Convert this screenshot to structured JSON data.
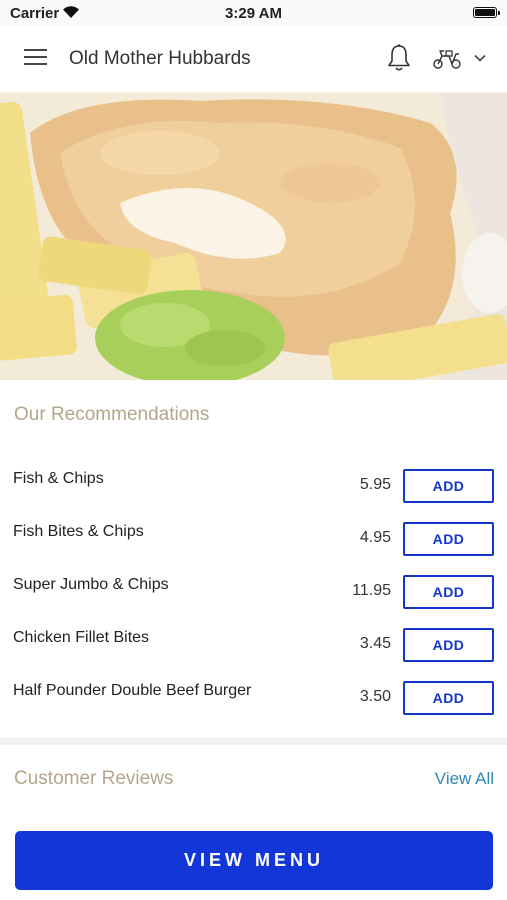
{
  "status_bar": {
    "carrier": "Carrier",
    "time": "3:29 AM"
  },
  "header": {
    "title": "Old Mother Hubbards",
    "menu_icon": "hamburger-menu-icon",
    "notification_icon": "bell-icon",
    "delivery_icon": "scooter-icon",
    "dropdown_icon": "chevron-down-icon"
  },
  "hero": {
    "image": "fish-and-chips-photo"
  },
  "recommendations": {
    "title": "Our Recommendations",
    "items": [
      {
        "name": "Fish & Chips",
        "price": "5.95",
        "action": "ADD"
      },
      {
        "name": "Fish Bites & Chips",
        "price": "4.95",
        "action": "ADD"
      },
      {
        "name": "Super Jumbo & Chips",
        "price": "11.95",
        "action": "ADD"
      },
      {
        "name": "Chicken Fillet Bites",
        "price": "3.45",
        "action": "ADD"
      },
      {
        "name": "Half Pounder Double Beef Burger",
        "price": "3.50",
        "action": "ADD"
      }
    ]
  },
  "reviews": {
    "title": "Customer Reviews",
    "view_all": "View All"
  },
  "footer": {
    "view_menu_label": "VIEW MENU"
  },
  "colors": {
    "brand_blue": "#1336d8",
    "accent_gold": "#b4a68a",
    "link_blue": "#2c8ab5"
  }
}
